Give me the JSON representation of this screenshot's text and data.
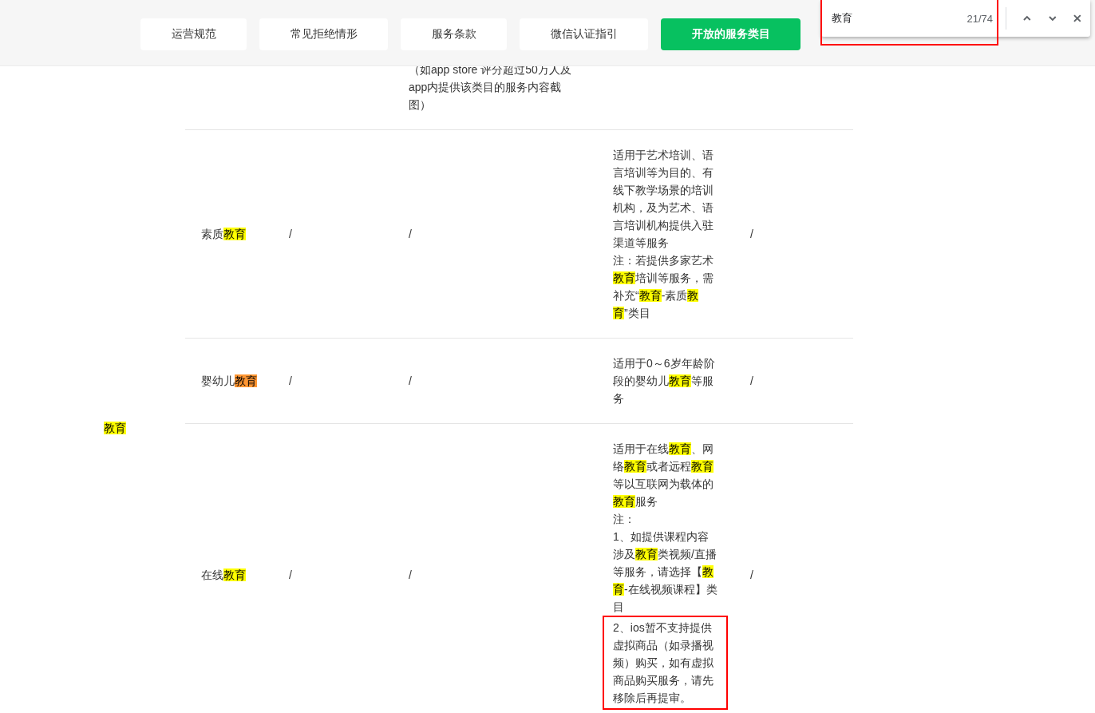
{
  "nav": {
    "buttons": [
      {
        "label": "运营规范",
        "selected": false
      },
      {
        "label": "常见拒绝情形",
        "selected": false
      },
      {
        "label": "服务条款",
        "selected": false
      },
      {
        "label": "微信认证指引",
        "selected": false
      },
      {
        "label": "开放的服务类目",
        "selected": true
      }
    ]
  },
  "find_bar": {
    "query": "教育",
    "count": "21/74",
    "boxed": true
  },
  "table": {
    "category": [
      {
        "text": "教育",
        "kind": "match"
      }
    ],
    "rows": [
      {
        "column_3": [
          [
            {
              "text": "（如app store 评分超过50万人及app内提供该类目的服务内容截图）",
              "kind": "plain"
            }
          ]
        ]
      },
      {
        "name": [
          {
            "text": "素质",
            "kind": "plain"
          },
          {
            "text": "教育",
            "kind": "match"
          }
        ],
        "column_2": "/",
        "column_3": [
          [
            {
              "text": "/",
              "kind": "plain"
            }
          ]
        ],
        "column_4": [
          {
            "boxed": false,
            "segments": [
              {
                "text": "适用于艺术培训、语言培训等为目的、有线下教学场景的培训机构，及为艺术、语言培训机构提供入驻渠道等服务",
                "kind": "plain"
              }
            ]
          },
          {
            "boxed": false,
            "segments": [
              {
                "text": "注：若提供多家艺术",
                "kind": "plain"
              },
              {
                "text": "教育",
                "kind": "match"
              },
              {
                "text": "培训等服务，需补充“",
                "kind": "plain"
              },
              {
                "text": "教育",
                "kind": "match"
              },
              {
                "text": "-素质",
                "kind": "plain"
              },
              {
                "text": "教育",
                "kind": "match"
              },
              {
                "text": "”类目",
                "kind": "plain"
              }
            ]
          }
        ],
        "column_5": "/"
      },
      {
        "name": [
          {
            "text": "婴幼儿",
            "kind": "plain"
          },
          {
            "text": "教育",
            "kind": "current"
          }
        ],
        "column_2": "/",
        "column_3": [
          [
            {
              "text": "/",
              "kind": "plain"
            }
          ]
        ],
        "column_4": [
          {
            "boxed": false,
            "segments": [
              {
                "text": "适用于0～6岁年龄阶段的婴幼儿",
                "kind": "plain"
              },
              {
                "text": "教育",
                "kind": "match"
              },
              {
                "text": "等服务",
                "kind": "plain"
              }
            ]
          }
        ],
        "column_5": "/"
      },
      {
        "name": [
          {
            "text": "在线",
            "kind": "plain"
          },
          {
            "text": "教育",
            "kind": "match"
          }
        ],
        "column_2": "/",
        "column_3": [
          [
            {
              "text": "/",
              "kind": "plain"
            }
          ]
        ],
        "column_4": [
          {
            "boxed": false,
            "segments": [
              {
                "text": "适用于在线",
                "kind": "plain"
              },
              {
                "text": "教育",
                "kind": "match"
              },
              {
                "text": "、网络",
                "kind": "plain"
              },
              {
                "text": "教育",
                "kind": "match"
              },
              {
                "text": "或者远程",
                "kind": "plain"
              },
              {
                "text": "教育",
                "kind": "match"
              },
              {
                "text": "等以互联网为载体的",
                "kind": "plain"
              },
              {
                "text": "教育",
                "kind": "match"
              },
              {
                "text": "服务",
                "kind": "plain"
              }
            ]
          },
          {
            "boxed": false,
            "segments": [
              {
                "text": "注：",
                "kind": "plain"
              }
            ]
          },
          {
            "boxed": false,
            "segments": [
              {
                "text": "1、如提供课程内容涉及",
                "kind": "plain"
              },
              {
                "text": "教育",
                "kind": "match"
              },
              {
                "text": "类视频/直播等服务，请选择【",
                "kind": "plain"
              },
              {
                "text": "教育",
                "kind": "match"
              },
              {
                "text": "-在线视频课程】类目",
                "kind": "plain"
              }
            ]
          },
          {
            "boxed": true,
            "segments": [
              {
                "text": "2、ios暂不支持提供虚拟商品（如录播视频）购买，如有虚拟商品购买服务，请先移除后再提审。",
                "kind": "plain"
              }
            ]
          }
        ],
        "column_5": "/"
      }
    ]
  }
}
